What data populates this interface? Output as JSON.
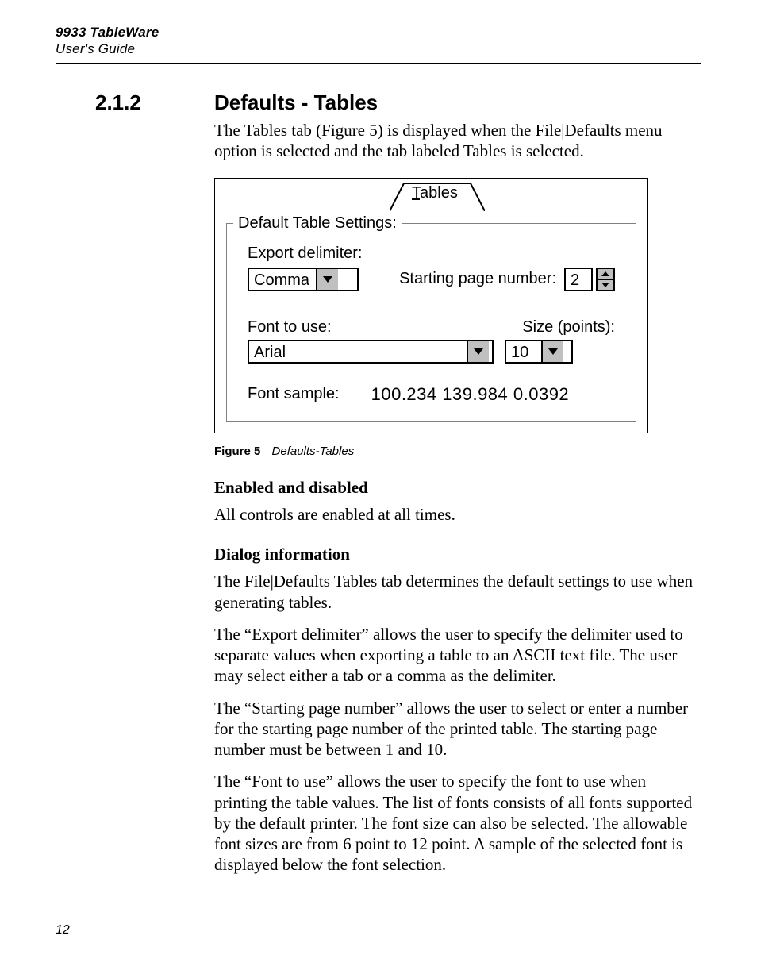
{
  "header": {
    "product": "9933 TableWare",
    "doc": "User's Guide"
  },
  "section": {
    "number": "2.1.2",
    "title": "Defaults - Tables"
  },
  "intro": "The Tables tab (Figure 5) is displayed when the File|Defaults menu option is selected and the tab labeled Tables is selected.",
  "dialog": {
    "tab_label": "Tables",
    "tab_mnemonic": "T",
    "group_title": "Default Table Settings:",
    "export_delim_label": "Export delimiter:",
    "export_delim_value": "Comma",
    "starting_page_label": "Starting page number:",
    "starting_page_value": "2",
    "font_label": "Font to use:",
    "font_value": "Arial",
    "size_label": "Size (points):",
    "size_value": "10",
    "sample_label": "Font sample:",
    "sample_value": "100.234 139.984 0.0392"
  },
  "figure": {
    "num": "Figure 5",
    "title": "Defaults-Tables"
  },
  "sub1_head": "Enabled and disabled",
  "sub1_text": "All controls are enabled at all times.",
  "sub2_head": "Dialog information",
  "sub2_p1": "The File|Defaults Tables tab determines the default settings to use when generating tables.",
  "sub2_p2": "The “Export delimiter” allows the user to specify the delimiter used to separate values when exporting a table to an ASCII text file. The user may select either a tab or a comma as the delimiter.",
  "sub2_p3": "The “Starting page number” allows the user to select or enter a number for the starting page number of the printed table. The starting page number must be between 1 and 10.",
  "sub2_p4": "The “Font to use” allows the user to specify the font to use when printing the table values. The list of fonts consists of all fonts supported by the default printer. The font size can also be selected. The allowable font sizes are from 6 point to 12 point. A sample of the selected font is displayed below the font selection.",
  "page_number": "12"
}
